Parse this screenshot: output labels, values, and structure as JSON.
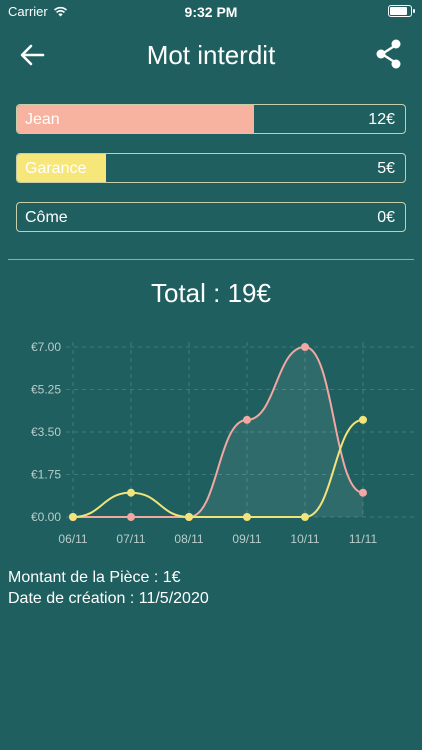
{
  "status": {
    "carrier": "Carrier",
    "time": "9:32 PM",
    "battery_level": 1.0
  },
  "header": {
    "title": "Mot interdit",
    "back_icon": "arrow-left-icon",
    "share_icon": "share-icon"
  },
  "players": [
    {
      "name": "Jean",
      "amount": "12€",
      "fill_fraction": 0.61,
      "color": "#f7b3a0"
    },
    {
      "name": "Garance",
      "amount": "5€",
      "fill_fraction": 0.23,
      "color": "#f7e67a"
    },
    {
      "name": "Côme",
      "amount": "0€",
      "fill_fraction": 0,
      "color": "#f7e67a"
    }
  ],
  "total": {
    "text": "Total : 19€"
  },
  "chart_data": {
    "type": "line",
    "categories": [
      "06/11",
      "07/11",
      "08/11",
      "09/11",
      "10/11",
      "11/11"
    ],
    "y_tick_labels": [
      "€0.00",
      "€1.75",
      "€3.50",
      "€5.25",
      "€7.00"
    ],
    "y_ticks": [
      0,
      1.75,
      3.5,
      5.25,
      7
    ],
    "ylim": [
      0,
      7
    ],
    "grid": true,
    "series": [
      {
        "values": [
          0,
          0,
          0,
          4,
          7,
          1
        ],
        "color": "#f2a7a2",
        "filled": true
      },
      {
        "values": [
          0,
          1,
          0,
          0,
          0,
          4
        ],
        "color": "#f2e37a",
        "filled": false
      }
    ]
  },
  "info": {
    "piece": "Montant de la Pièce : 1€",
    "created": "Date de création : 11/5/2020"
  }
}
